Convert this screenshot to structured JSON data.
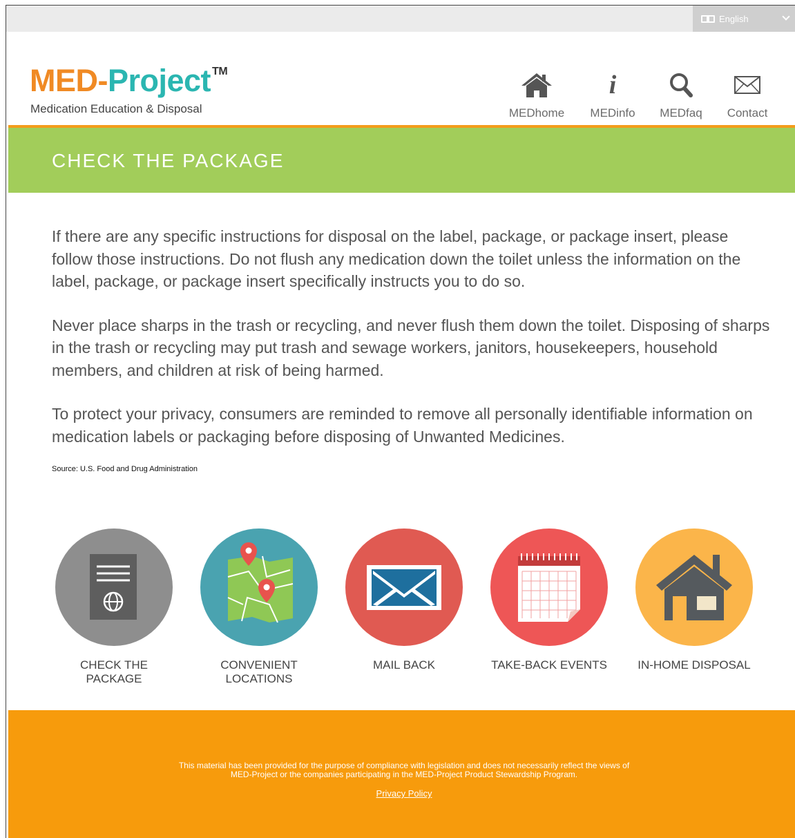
{
  "language": {
    "selected": "English",
    "icon": "translate-icon"
  },
  "logo": {
    "part1": "MED-",
    "part2": "Project",
    "tm": "TM",
    "tagline": "Medication Education & Disposal"
  },
  "nav": [
    {
      "label": "MEDhome",
      "icon": "home-icon"
    },
    {
      "label": "MEDinfo",
      "icon": "info-icon",
      "glyph": "i"
    },
    {
      "label": "MEDfaq",
      "icon": "search-icon"
    },
    {
      "label": "Contact",
      "icon": "envelope-icon"
    }
  ],
  "banner": {
    "title": "CHECK THE PACKAGE"
  },
  "content": {
    "paragraphs": [
      "If there are any specific instructions for disposal on the label, package, or package insert, please follow those instructions. Do not flush any medication down the toilet unless the information on the label, package, or package insert specifically instructs you to do so.",
      "Never place sharps in the trash or recycling, and never flush them down the toilet. Disposing of sharps in the trash or recycling may put trash and sewage workers, janitors, housekeepers, household members, and children at risk of being harmed.",
      "To protect your privacy, consumers are reminded to remove all personally identifiable information on medication labels or packaging before disposing of Unwanted Medicines."
    ],
    "source": "Source: U.S. Food and Drug Administration"
  },
  "options": [
    {
      "line1": "CHECK THE",
      "line2": "PACKAGE",
      "color": "#8e8e8e",
      "icon": "package-insert-icon"
    },
    {
      "line1": "CONVENIENT",
      "line2": "LOCATIONS",
      "color": "#4aa3b0",
      "icon": "map-icon"
    },
    {
      "line1": "MAIL BACK",
      "line2": "",
      "color": "#e05a52",
      "icon": "envelope-icon"
    },
    {
      "line1": "TAKE-BACK EVENTS",
      "line2": "",
      "color": "#ee5656",
      "icon": "calendar-icon"
    },
    {
      "line1": "IN-HOME DISPOSAL",
      "line2": "",
      "color": "#fbb54a",
      "icon": "house-icon"
    }
  ],
  "footer": {
    "line1": "This material has been provided for the purpose of compliance with legislation and does not necessarily reflect the views of",
    "line2": "MED-Project or the companies participating in the MED-Project Product Stewardship Program.",
    "privacy": "Privacy Policy"
  },
  "colors": {
    "orange": "#f08a24",
    "teal": "#2bb6b1",
    "green_banner": "#a2cd5a",
    "footer_orange": "#f79b0c"
  }
}
